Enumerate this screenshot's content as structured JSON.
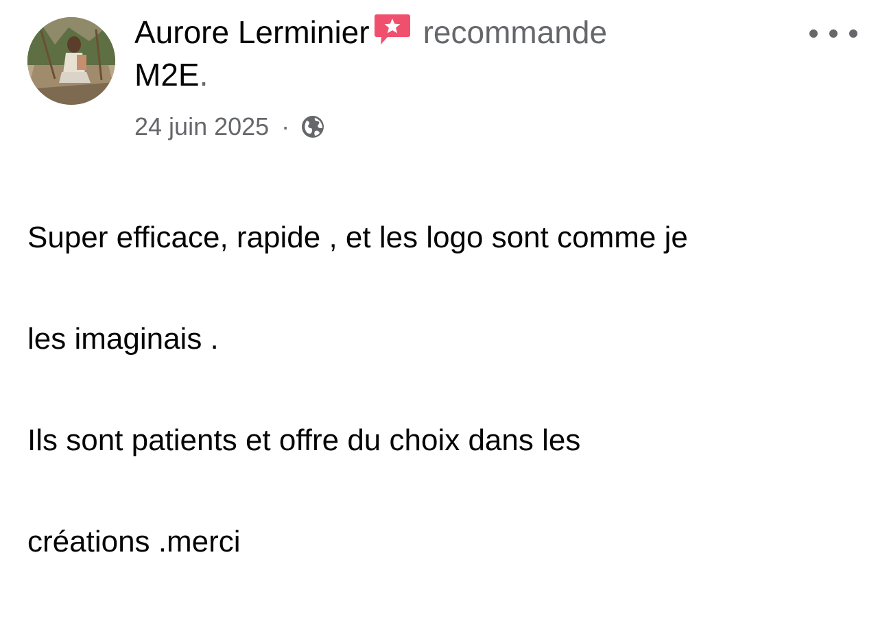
{
  "post": {
    "author": "Aurore Lerminier",
    "action": "recommande",
    "page": "M2E",
    "page_suffix": ".",
    "date": "24 juin 2025",
    "separator": "·",
    "text_line_1": "Super efficace, rapide , et les logo sont comme je",
    "text_line_2": "les imaginais .",
    "text_line_3": "Ils sont patients et offre du choix dans les",
    "text_line_4": "créations .merci"
  },
  "icons": {
    "recommendation": "recommend-star-icon",
    "audience": "globe-icon",
    "menu": "more-options-icon"
  },
  "colors": {
    "primary_text": "#050505",
    "secondary_text": "#65676b",
    "recommend_badge": "#f0506e"
  }
}
